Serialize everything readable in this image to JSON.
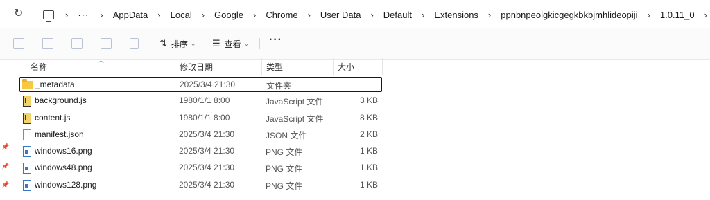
{
  "address_bar": {
    "refresh_icon": "refresh-icon",
    "computer_icon": "computer-icon",
    "breadcrumbs": [
      "AppData",
      "Local",
      "Google",
      "Chrome",
      "User Data",
      "Default",
      "Extensions",
      "ppnbnpeolgkicgegkbkbjmhlideopiji",
      "1.0.11_0"
    ],
    "ellipsis": "···"
  },
  "toolbar": {
    "sort_label": "排序",
    "view_label": "查看",
    "more_label": "···"
  },
  "columns": {
    "name": "名称",
    "date": "修改日期",
    "type": "类型",
    "size": "大小"
  },
  "files": [
    {
      "name": "_metadata",
      "date": "2025/3/4 21:30",
      "type": "文件夹",
      "size": "",
      "icon": "folder-icon"
    },
    {
      "name": "background.js",
      "date": "1980/1/1 8:00",
      "type": "JavaScript 文件",
      "size": "3 KB",
      "icon": "js-file-icon"
    },
    {
      "name": "content.js",
      "date": "1980/1/1 8:00",
      "type": "JavaScript 文件",
      "size": "8 KB",
      "icon": "js-file-icon"
    },
    {
      "name": "manifest.json",
      "date": "2025/3/4 21:30",
      "type": "JSON 文件",
      "size": "2 KB",
      "icon": "json-file-icon"
    },
    {
      "name": "windows16.png",
      "date": "2025/3/4 21:30",
      "type": "PNG 文件",
      "size": "1 KB",
      "icon": "png-file-icon"
    },
    {
      "name": "windows48.png",
      "date": "2025/3/4 21:30",
      "type": "PNG 文件",
      "size": "1 KB",
      "icon": "png-file-icon"
    },
    {
      "name": "windows128.png",
      "date": "2025/3/4 21:30",
      "type": "PNG 文件",
      "size": "1 KB",
      "icon": "png-file-icon"
    }
  ]
}
